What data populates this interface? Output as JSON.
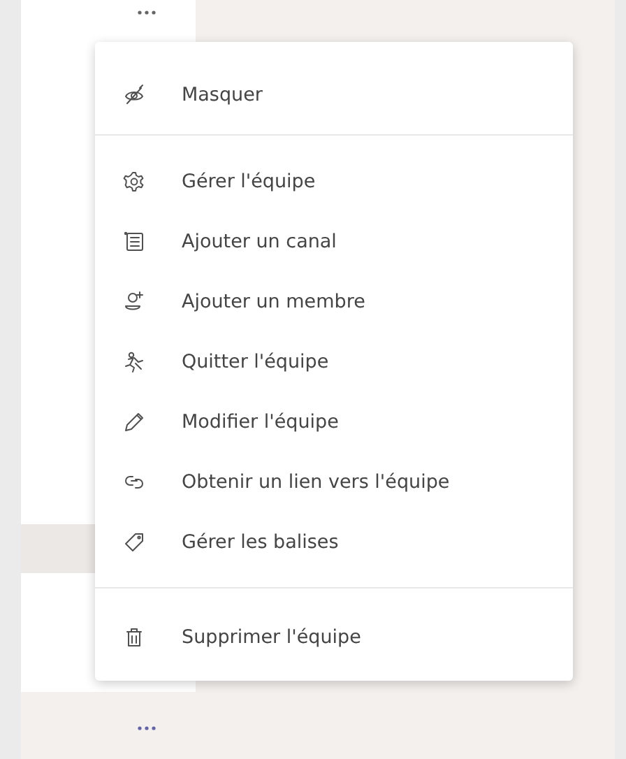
{
  "menu": {
    "groups": [
      [
        {
          "label": "Masquer"
        }
      ],
      [
        {
          "label": "Gérer l'équipe"
        },
        {
          "label": "Ajouter un canal"
        },
        {
          "label": "Ajouter un membre"
        },
        {
          "label": "Quitter l'équipe"
        },
        {
          "label": "Modifier l'équipe"
        },
        {
          "label": "Obtenir un lien vers l'équipe"
        },
        {
          "label": "Gérer les balises"
        }
      ],
      [
        {
          "label": "Supprimer l'équipe"
        }
      ]
    ]
  }
}
